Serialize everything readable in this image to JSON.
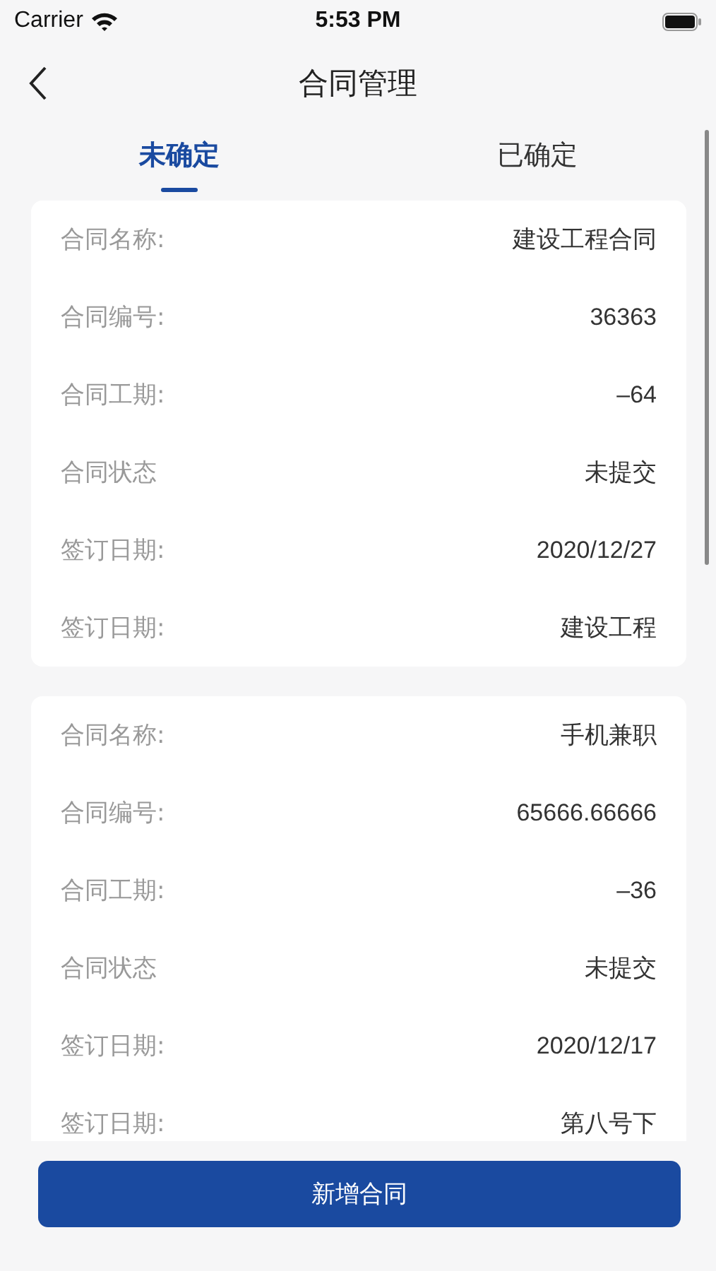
{
  "status_bar": {
    "carrier": "Carrier",
    "time": "5:53 PM"
  },
  "nav": {
    "title": "合同管理"
  },
  "tabs": [
    {
      "label": "未确定",
      "selected": true
    },
    {
      "label": "已确定",
      "selected": false
    }
  ],
  "contracts": [
    {
      "rows": [
        {
          "label": "合同名称:",
          "value": "建设工程合同"
        },
        {
          "label": "合同编号:",
          "value": "36363"
        },
        {
          "label": "合同工期:",
          "value": "–64"
        },
        {
          "label": "合同状态",
          "value": "未提交"
        },
        {
          "label": "签订日期:",
          "value": "2020/12/27"
        },
        {
          "label": "签订日期:",
          "value": "建设工程"
        }
      ]
    },
    {
      "rows": [
        {
          "label": "合同名称:",
          "value": "手机兼职"
        },
        {
          "label": "合同编号:",
          "value": "65666.66666"
        },
        {
          "label": "合同工期:",
          "value": "–36"
        },
        {
          "label": "合同状态",
          "value": "未提交"
        },
        {
          "label": "签订日期:",
          "value": "2020/12/17"
        },
        {
          "label": "签订日期:",
          "value": "第八号下"
        }
      ]
    }
  ],
  "add_button": "新增合同"
}
